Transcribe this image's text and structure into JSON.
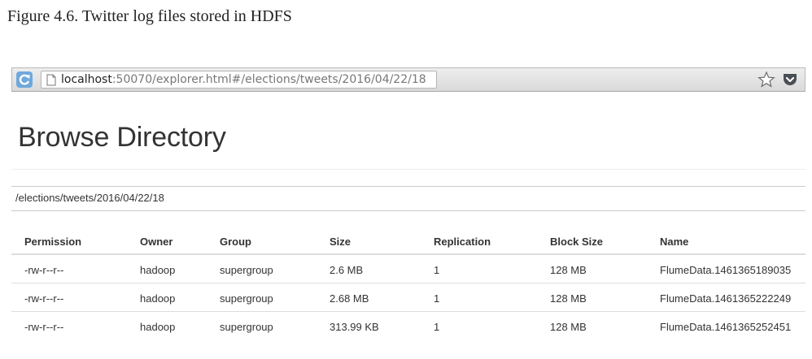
{
  "caption": "Figure 4.6. Twitter log files stored in HDFS",
  "browser": {
    "url_host": "localhost",
    "url_rest": ":50070/explorer.html#/elections/tweets/2016/04/22/18",
    "icons": [
      "reload-icon",
      "page-icon",
      "star-icon",
      "pocket-icon"
    ]
  },
  "page": {
    "title": "Browse Directory",
    "path": "/elections/tweets/2016/04/22/18"
  },
  "table": {
    "headers": [
      "Permission",
      "Owner",
      "Group",
      "Size",
      "Replication",
      "Block Size",
      "Name"
    ],
    "rows": [
      {
        "permission": "-rw-r--r--",
        "owner": "hadoop",
        "group": "supergroup",
        "size": "2.6 MB",
        "replication": "1",
        "block_size": "128 MB",
        "name": "FlumeData.1461365189035"
      },
      {
        "permission": "-rw-r--r--",
        "owner": "hadoop",
        "group": "supergroup",
        "size": "2.68 MB",
        "replication": "1",
        "block_size": "128 MB",
        "name": "FlumeData.1461365222249"
      },
      {
        "permission": "-rw-r--r--",
        "owner": "hadoop",
        "group": "supergroup",
        "size": "313.99 KB",
        "replication": "1",
        "block_size": "128 MB",
        "name": "FlumeData.1461365252451"
      }
    ]
  },
  "colors": {
    "link": "#428bca",
    "reload_icon": "#4a90d9",
    "pocket_icon": "#4a4f55"
  }
}
